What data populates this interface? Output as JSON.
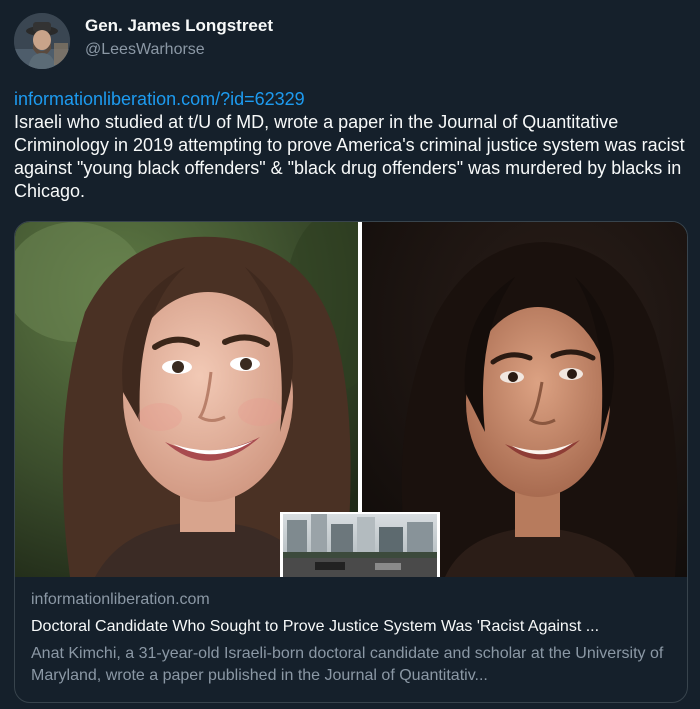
{
  "author": {
    "name": "Gen. James Longstreet",
    "handle": "@LeesWarhorse",
    "avatar_icon": "avatar-portrait-icon"
  },
  "tweet": {
    "link_text": "informationliberation.com/?id=62329",
    "text": "Israeli who studied at t/U of MD, wrote a paper in the Journal of Quantitative Criminology in 2019 attempting to prove America's criminal justice system was racist against \"young black offenders\" & \"black drug offenders\" was murdered by blacks in Chicago."
  },
  "card": {
    "domain": "informationliberation.com",
    "title": "Doctoral Candidate Who Sought to Prove Justice System Was 'Racist Against ...",
    "description": "Anat Kimchi, a 31-year-old Israeli-born doctoral candidate and scholar at the University of Maryland, wrote a paper published in the Journal of Quantitativ..."
  },
  "colors": {
    "background": "#15202b",
    "text_primary": "#f7f9f9",
    "text_secondary": "#8b98a5",
    "link": "#1d9bf0",
    "border": "#38444d"
  }
}
